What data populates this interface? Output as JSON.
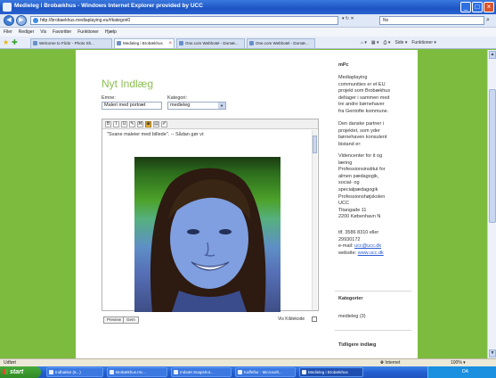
{
  "window": {
    "title": "Medieleg i Brobækhus - Windows Internet Explorer provided by UCC",
    "minimize": "_",
    "maximize": "□",
    "close": "×"
  },
  "addressbar": {
    "back": "◀",
    "forward": "▶",
    "url": "http://brobaekhus.mediaplaying.eu/#kategori0",
    "buttons": "▾ ↻ ✕",
    "search_value": "Nv",
    "search_go": "⌕"
  },
  "menubar": [
    "Filer",
    "Rediger",
    "Vis",
    "Favoritter",
    "Funktioner",
    "Hjælp"
  ],
  "tabs": [
    {
      "label": "Welcome to Flickr - Photo Sh...",
      "active": false
    },
    {
      "label": "Medieleg i Brobækhus",
      "active": true
    },
    {
      "label": "One.com Webhotel - Domæ...",
      "active": false
    },
    {
      "label": "One.com Webhotel - Domæ...",
      "active": false
    }
  ],
  "tab_tools": [
    "Side ▾",
    "Funktioner ▾"
  ],
  "form": {
    "heading": "Nyt Indlæg",
    "subject_label": "Emne:",
    "subject_value": "Maleri med portræt",
    "category_label": "Kategori:",
    "category_value": "medieleg",
    "toolbar_buttons": [
      "B",
      "I",
      "U",
      "✎",
      "⌘",
      "▣",
      "▤",
      "✐"
    ],
    "editor_text": "\"Svane maleier med billede\". -- Sådan gør vi:",
    "preview_button": "Preview",
    "save_button": "Gem",
    "source_label": "Vis Kildekode"
  },
  "sidebar": {
    "about_heading": "mPc",
    "about_lines": [
      "Mediaplaying",
      "communities er et EU",
      "projekt som Brobækhus",
      "deltager i sammen med",
      "tre andre børnehaver",
      "fra Gentofte kommune."
    ],
    "partner_lines": [
      "Den danske partner i",
      "projektet, som yder",
      "børnehaven konsulent",
      "bistand er:"
    ],
    "center_lines": [
      "Videncenter for it og",
      "læring",
      "Professionsinstitut for",
      "almen pædagogik,",
      "social- og",
      "specialpædagogik",
      "Professionshøjskolen",
      "UCC",
      "Titangade 11",
      "2200 København N"
    ],
    "phone_lines": [
      "tlf. 3586 8310 eller",
      "29930172"
    ],
    "email_prefix": "e-mail: ",
    "email": "ucc@ucc.dk",
    "website_prefix": "website: ",
    "website": "www.ucc.dk",
    "categories_heading": "Kategorier",
    "category_item": "medieleg (3)",
    "earlier_heading": "Tidligere indlæg"
  },
  "statusbar": {
    "left": "Udført",
    "zone": "Internet",
    "zoom": "100% ▾"
  },
  "taskbar": {
    "start": "start",
    "tasks": [
      {
        "label": "Indbakke (6...)",
        "active": false
      },
      {
        "label": "Brobækhus.mc...",
        "active": false
      },
      {
        "label": "Indsæt Snapshot...",
        "active": false
      },
      {
        "label": "Kaffeflor - Microsoft...",
        "active": false
      },
      {
        "label": "Medieleg i Brobækhus",
        "active": true
      }
    ],
    "clock": "DA"
  },
  "colors": {
    "page_green": "#7dbb3e",
    "heading_green": "#8cc052",
    "link_blue": "#2a5bd7"
  }
}
